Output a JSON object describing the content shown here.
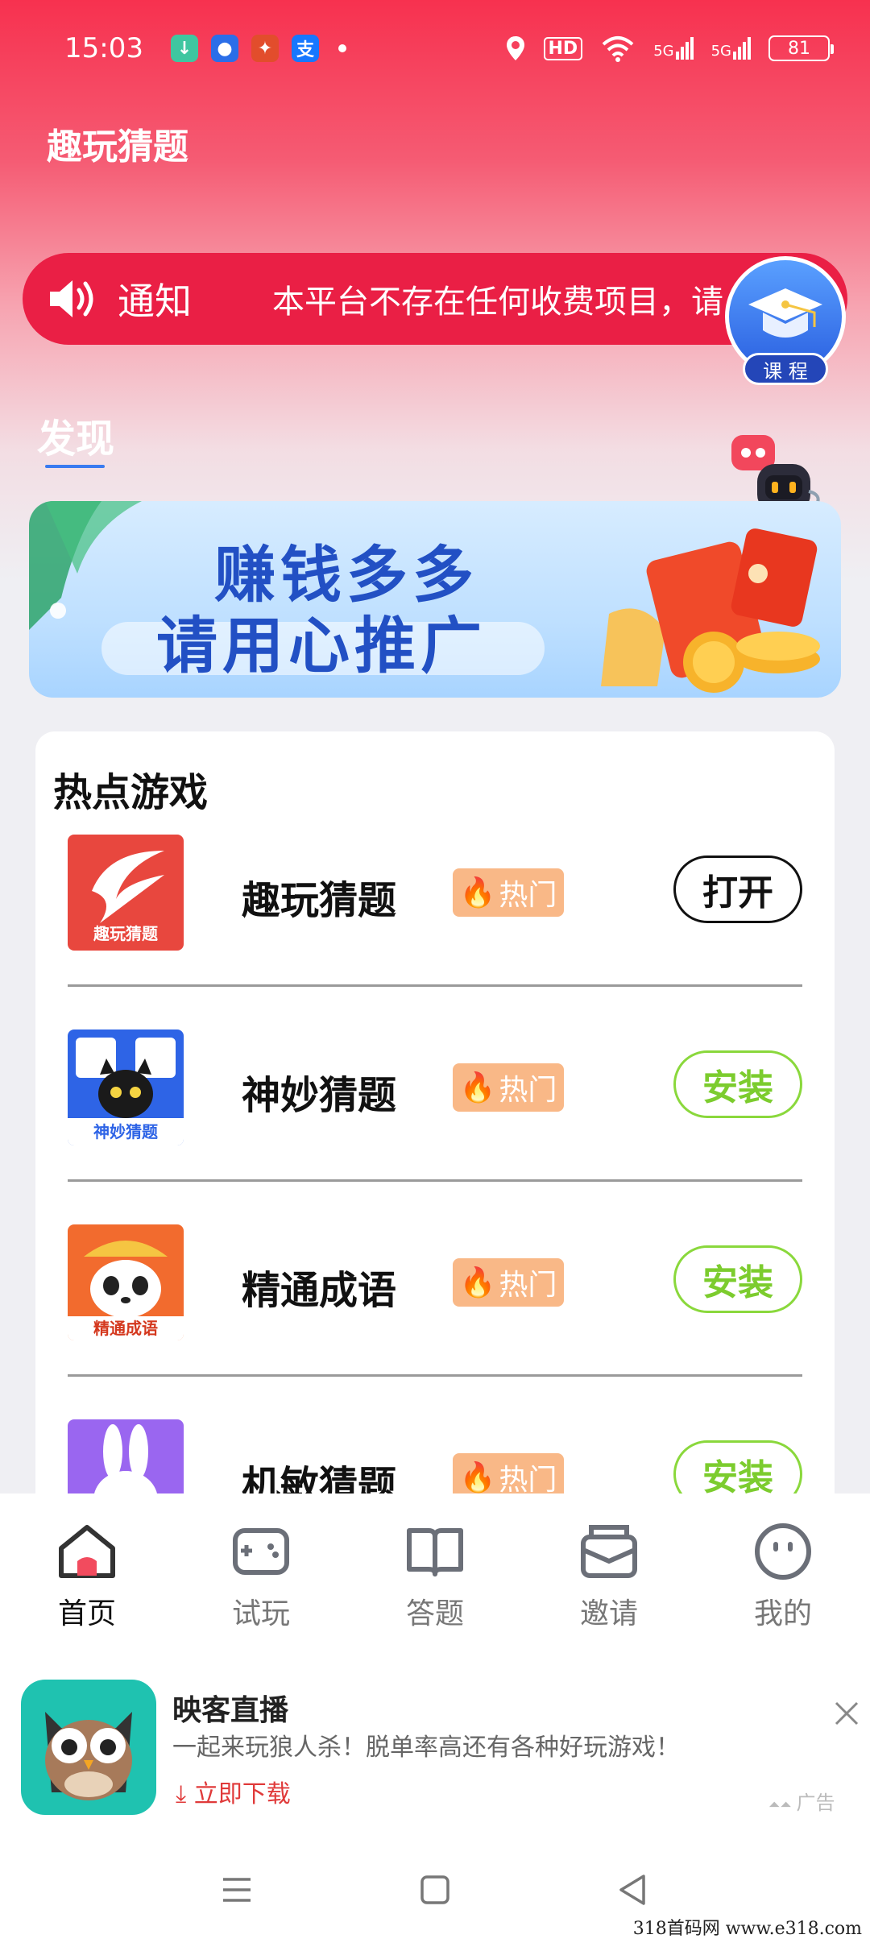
{
  "status": {
    "time": "15:03",
    "hd": "HD",
    "battery": "81",
    "network": "5G",
    "notif_icons": [
      "download-icon",
      "qq-browser-icon",
      "fortune-app-icon",
      "alipay-icon"
    ],
    "alipay_char": "支",
    "colors": {
      "download": "#3fc6a0",
      "qq": "#2b6ee8",
      "fortune": "#e24d2c",
      "alipay": "#1677ff"
    }
  },
  "app": {
    "title": "趣玩猜题"
  },
  "notice": {
    "label": "通知",
    "text": "本平台不存在任何收费项目，请"
  },
  "course": {
    "label": "课 程"
  },
  "discover": {
    "tab": "发现"
  },
  "service": {
    "label": "客服"
  },
  "banner": {
    "line1": "赚钱多多",
    "line2": "请用心推广"
  },
  "games": {
    "title": "热点游戏",
    "hot_label": "热门",
    "items": [
      {
        "name": "趣玩猜题",
        "icon_text": "趣玩猜题",
        "action": "打开",
        "action_type": "open",
        "icon_color": "#e8473e"
      },
      {
        "name": "神妙猜题",
        "icon_text": "神妙猜题",
        "action": "安装",
        "action_type": "install",
        "icon_color": "#2e64e6"
      },
      {
        "name": "精通成语",
        "icon_text": "精通成语",
        "action": "安装",
        "action_type": "install",
        "icon_color": "#f26b2e"
      },
      {
        "name": "机敏猜题",
        "icon_text": "",
        "action": "安装",
        "action_type": "install",
        "icon_color": "#9a66f0"
      }
    ]
  },
  "nav": [
    {
      "label": "首页",
      "icon": "home-icon",
      "active": true
    },
    {
      "label": "试玩",
      "icon": "gamepad-icon",
      "active": false
    },
    {
      "label": "答题",
      "icon": "book-icon",
      "active": false
    },
    {
      "label": "邀请",
      "icon": "mail-icon",
      "active": false
    },
    {
      "label": "我的",
      "icon": "profile-icon",
      "active": false
    }
  ],
  "ad": {
    "name": "映客直播",
    "desc": "一起来玩狼人杀！脱单率高还有各种好玩游戏！",
    "download": "立即下载",
    "tag": "广告"
  },
  "watermark": "318首码网 www.e318.com"
}
